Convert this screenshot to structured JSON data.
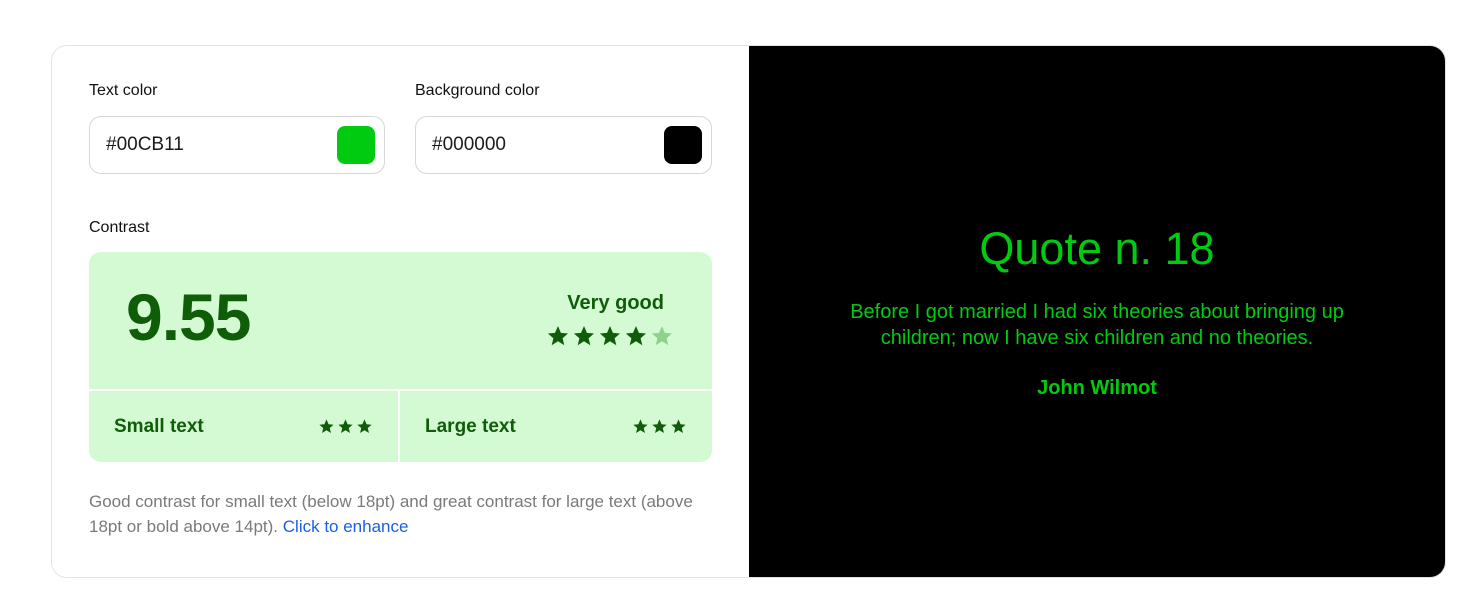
{
  "controls": {
    "text_color_label": "Text color",
    "text_color_value": "#00CB11",
    "background_color_label": "Background color",
    "background_color_value": "#000000",
    "contrast_label": "Contrast"
  },
  "contrast": {
    "score": "9.55",
    "rating": "Very good",
    "rating_stars": 4,
    "max_stars": 5,
    "small_text_label": "Small text",
    "small_text_stars": 3,
    "large_text_label": "Large text",
    "large_text_stars": 3,
    "note_text": "Good contrast for small text (below 18pt) and great contrast for large text (above 18pt or bold above 14pt).",
    "enhance_link": "Click to enhance"
  },
  "preview": {
    "title": "Quote n. 18",
    "quote": "Before I got married I had six theories about bringing up children; now I have six children and no theories.",
    "author": "John Wilmot"
  },
  "colors": {
    "text": "#00CB11",
    "background": "#000000",
    "box_bg": "#d4fad3",
    "star_on": "#0f5d09",
    "star_off": "#8fd28b"
  },
  "icons": {
    "star": "star-icon",
    "swatch": "color-swatch-icon"
  }
}
